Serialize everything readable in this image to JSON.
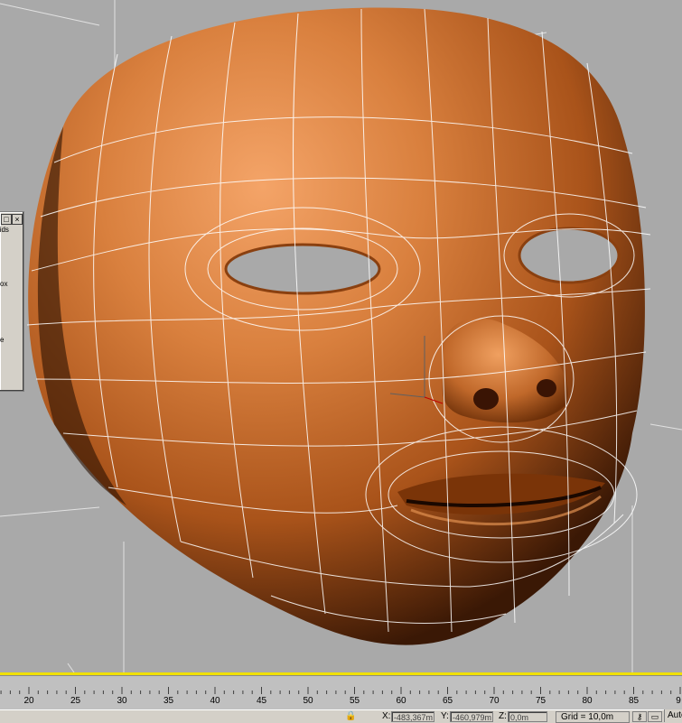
{
  "viewport": {
    "label": "Perspective viewport showing orange face mask mesh with wireframe overlay",
    "colors": {
      "background": "#a9a9a9",
      "mesh": "#c8682a",
      "wire": "#ffffff"
    }
  },
  "floater": {
    "tab_label": "rids",
    "text_1": "ox",
    "text_2": "e"
  },
  "timeline": {
    "ticks": [
      "20",
      "25",
      "30",
      "35",
      "40",
      "45",
      "50",
      "55",
      "60",
      "65",
      "70",
      "75",
      "80",
      "85",
      "9"
    ]
  },
  "status": {
    "x_label": "X:",
    "x_value": "-483,367m",
    "y_label": "Y:",
    "y_value": "-460,979m",
    "z_label": "Z:",
    "z_value": "0,0m",
    "grid": "Grid = 10,0m",
    "auto_label": "Auto"
  }
}
